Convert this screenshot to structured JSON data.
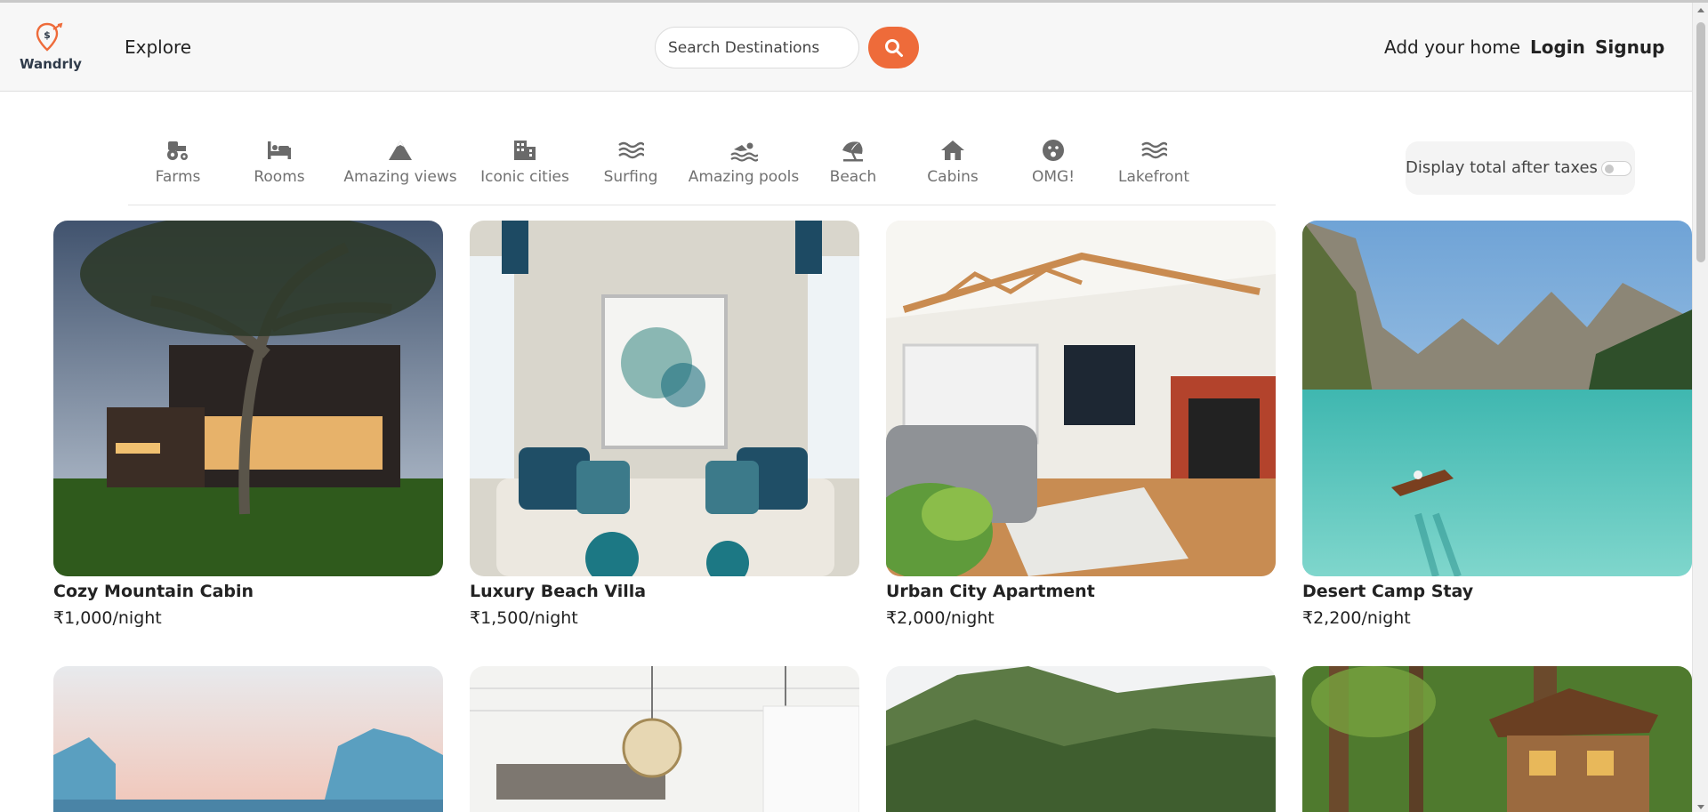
{
  "brand": {
    "name": "Wandrly"
  },
  "nav": {
    "explore": "Explore",
    "search_placeholder": "Search Destinations",
    "add_home": "Add your home",
    "login": "Login",
    "signup": "Signup"
  },
  "filters": [
    {
      "label": "Farms",
      "icon": "tractor-icon"
    },
    {
      "label": "Rooms",
      "icon": "bed-icon"
    },
    {
      "label": "Amazing views",
      "icon": "mountain-icon"
    },
    {
      "label": "Iconic cities",
      "icon": "city-icon"
    },
    {
      "label": "Surfing",
      "icon": "waves-icon"
    },
    {
      "label": "Amazing pools",
      "icon": "swimmer-icon"
    },
    {
      "label": "Beach",
      "icon": "umbrella-beach-icon"
    },
    {
      "label": "Cabins",
      "icon": "house-icon"
    },
    {
      "label": "OMG!",
      "icon": "surprised-face-icon"
    },
    {
      "label": "Lakefront",
      "icon": "water-icon"
    }
  ],
  "tax_toggle": {
    "label": "Display total after taxes",
    "enabled": false
  },
  "listings": [
    {
      "title": "Cozy Mountain Cabin",
      "price": "₹1,000/night"
    },
    {
      "title": "Luxury Beach Villa",
      "price": "₹1,500/night"
    },
    {
      "title": "Urban City Apartment",
      "price": "₹2,000/night"
    },
    {
      "title": "Desert Camp Stay",
      "price": "₹2,200/night"
    }
  ],
  "colors": {
    "accent": "#ee6b3a",
    "navbar_bg": "#f7f7f7",
    "text": "#222222",
    "muted": "#717171"
  }
}
